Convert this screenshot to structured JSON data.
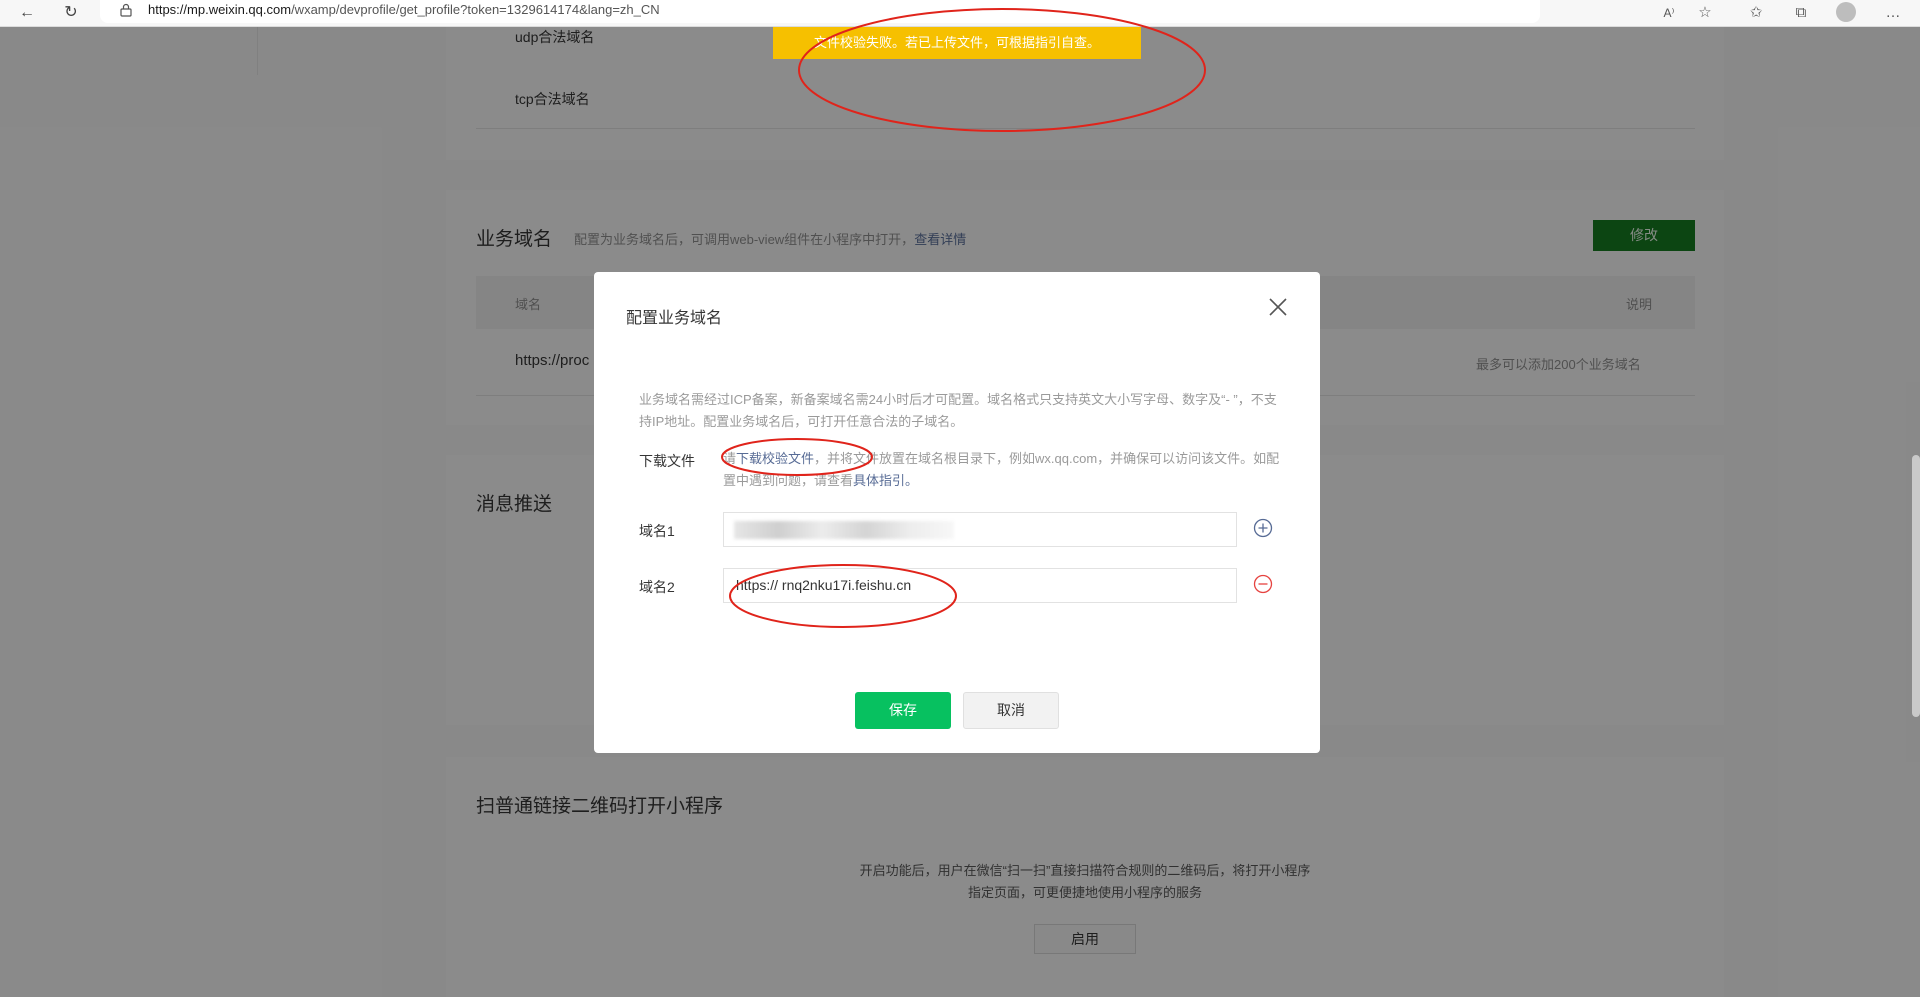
{
  "browser": {
    "url_host": "https://mp.weixin.qq.com",
    "url_path": "/wxamp/devprofile/get_profile?token=1329614174&lang=zh_CN"
  },
  "page": {
    "udp_label": "udp合法域名",
    "tcp_label": "tcp合法域名",
    "biz_section_title": "业务域名",
    "biz_section_desc": "配置为业务域名后，可调用web-view组件在小程序中打开，",
    "biz_section_link": "查看详情",
    "modify_button": "修改",
    "table_col_domain": "域名",
    "table_col_desc": "说明",
    "table_row_domain": "https://proc",
    "table_row_desc": "最多可以添加200个业务域名",
    "msg_section_title": "消息推送",
    "qr_section_title": "扫普通链接二维码打开小程序",
    "qr_desc_line1": "开启功能后，用户在微信“扫一扫”直接扫描符合规则的二维码后，将打开小程序",
    "qr_desc_line2": "指定页面，可更便捷地使用小程序的服务",
    "enable_button": "启用"
  },
  "toast": {
    "message": "文件校验失败。若已上传文件，可根据指引自查。"
  },
  "dialog": {
    "title": "配置业务域名",
    "desc": "业务域名需经过ICP备案，新备案域名需24小时后才可配置。域名格式只支持英文大小写字母、数字及“- ”，不支持IP地址。配置业务域名后，可打开任意合法的子域名。",
    "download_label": "下载文件",
    "download_prefix": "请",
    "download_link": "下载校验文件",
    "download_text": "，并将文件放置在域名根目录下，例如wx.qq.com，并确保可以访问该文件。如配置中遇到问题，请查看",
    "guide_link": "具体指引。",
    "domain1_label": "域名1",
    "domain1_value": "",
    "domain2_label": "域名2",
    "domain2_value": "https:// rnq2nku17i.feishu.cn",
    "save_button": "保存",
    "cancel_button": "取消"
  }
}
